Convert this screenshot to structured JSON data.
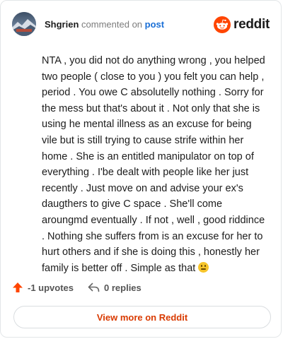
{
  "header": {
    "username": "Shgrien",
    "commented_text": "commented on",
    "post_link": "post",
    "logo_text": "reddit",
    "brand_color": "#ff4500"
  },
  "comment": {
    "text": "NTA , you did not do anything wrong , you helped two people ( close to you ) you felt you can help , period . You owe C absolutelly nothing . Sorry for the mess but that's about it . Not only that she is using he mental illness as an excuse for being vile but is still trying to cause strife within her home . She is an entitled manipulator on top of everything . I'be dealt with people like her just recently . Just move on and advise your ex's daugthers to give C space . She'll come aroungmd eventually . If not , well , good riddince . Nothing she suffers from is an excuse for her to hurt others and if she is doing this , honestly her family is better off . Simple as that",
    "emoji": "slightly-smiling-face"
  },
  "actions": {
    "upvotes": "-1 upvotes",
    "replies": "0 replies"
  },
  "footer": {
    "view_more": "View more on Reddit"
  }
}
